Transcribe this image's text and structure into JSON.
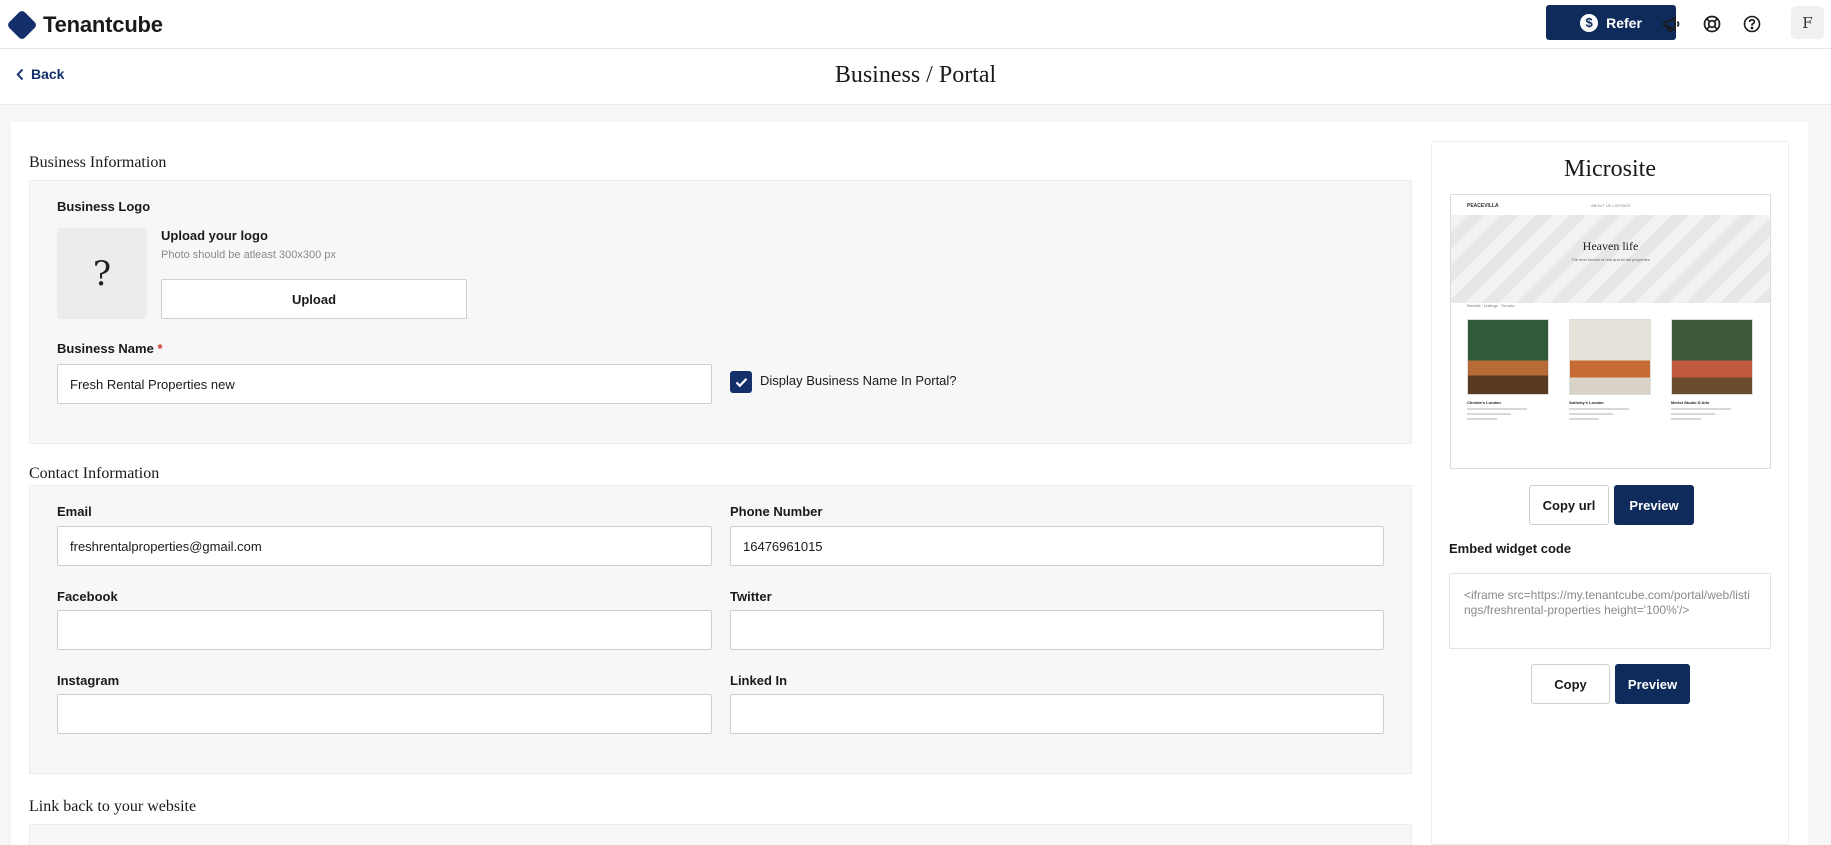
{
  "brand": {
    "name": "Tenantcube",
    "color": "#14306b"
  },
  "topbar": {
    "refer_label": "Refer",
    "refer_icon": "$",
    "avatar_initial": "F",
    "icons": [
      "megaphone-icon",
      "support-icon",
      "help-icon"
    ]
  },
  "subheader": {
    "back_label": "Back",
    "title": "Business / Portal"
  },
  "business_info": {
    "title": "Business Information",
    "logo_label": "Business Logo",
    "logo_placeholder": "?",
    "upload_title": "Upload your logo",
    "upload_hint": "Photo should be atleast 300x300 px",
    "upload_button": "Upload",
    "name_label": "Business Name",
    "required_mark": "*",
    "name_value": "Fresh Rental Properties new",
    "display_name_checkbox_label": "Display Business Name In Portal?",
    "display_name_checked": true
  },
  "contact_info": {
    "title": "Contact Information",
    "email_label": "Email",
    "email_value": "freshrentalproperties@gmail.com",
    "phone_label": "Phone Number",
    "phone_value": "16476961015",
    "facebook_label": "Facebook",
    "facebook_value": "",
    "twitter_label": "Twitter",
    "twitter_value": "",
    "instagram_label": "Instagram",
    "instagram_value": "",
    "linkedin_label": "Linked In",
    "linkedin_value": ""
  },
  "link_back": {
    "title": "Link back to your website"
  },
  "microsite": {
    "title": "Microsite",
    "copy_url_label": "Copy url",
    "preview_label": "Preview",
    "embed_label": "Embed widget code",
    "embed_code": "<iframe src=https://my.tenantcube.com/portal/web/listings/freshrental-properties height='100%'/>",
    "copy_label": "Copy",
    "preview_label_2": "Preview",
    "preview_mock": {
      "logo": "PEACEVILLA",
      "nav": "ABOUT US     LISTINGS",
      "hero_title": "Heaven life",
      "hero_subtitle": "The best homes of rest and rental properties",
      "crumb": "Rentals  ·  Listings  ·  Toronto",
      "cards": [
        {
          "name": "Christie's London",
          "color_a": "#2f5a3b",
          "color_b": "#b86a37"
        },
        {
          "name": "Sotheby's London",
          "color_a": "#e6e2da",
          "color_b": "#c76b35"
        },
        {
          "name": "Merlot Studio D'Arte",
          "color_a": "#3c5a3a",
          "color_b": "#c05a3e"
        }
      ]
    }
  },
  "colors": {
    "primary": "#0f2b5b",
    "required": "#d0342c"
  }
}
